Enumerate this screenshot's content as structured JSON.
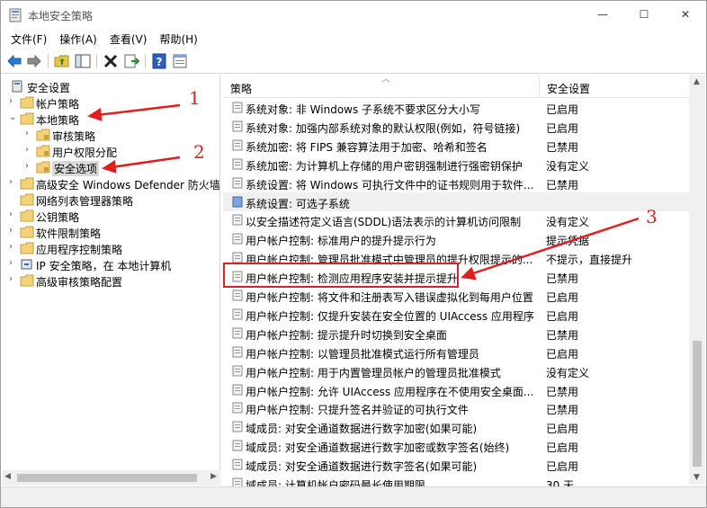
{
  "window": {
    "title": "本地安全策略",
    "min_glyph": "—",
    "max_glyph": "☐",
    "close_glyph": "✕"
  },
  "menu": [
    "文件(F)",
    "操作(A)",
    "查看(V)",
    "帮助(H)"
  ],
  "tree": [
    {
      "label": "安全设置",
      "level": 0,
      "expanded": true,
      "icon": "security-settings-icon"
    },
    {
      "label": "帐户策略",
      "level": 1,
      "expanded": false,
      "icon": "folder-icon"
    },
    {
      "label": "本地策略",
      "level": 1,
      "expanded": true,
      "icon": "folder-icon"
    },
    {
      "label": "审核策略",
      "level": 2,
      "expanded": false,
      "icon": "folder-icon"
    },
    {
      "label": "用户权限分配",
      "level": 2,
      "expanded": false,
      "icon": "folder-icon"
    },
    {
      "label": "安全选项",
      "level": 2,
      "expanded": false,
      "icon": "folder-icon",
      "selected": true
    },
    {
      "label": "高级安全 Windows Defender 防火墙",
      "level": 1,
      "expanded": false,
      "icon": "folder-icon"
    },
    {
      "label": "网络列表管理器策略",
      "level": 1,
      "expanded": null,
      "icon": "folder-icon"
    },
    {
      "label": "公钥策略",
      "level": 1,
      "expanded": false,
      "icon": "folder-icon"
    },
    {
      "label": "软件限制策略",
      "level": 1,
      "expanded": false,
      "icon": "folder-icon"
    },
    {
      "label": "应用程序控制策略",
      "level": 1,
      "expanded": false,
      "icon": "folder-icon"
    },
    {
      "label": "IP 安全策略，在 本地计算机",
      "level": 1,
      "expanded": false,
      "icon": "ip-security-icon"
    },
    {
      "label": "高级审核策略配置",
      "level": 1,
      "expanded": false,
      "icon": "folder-icon"
    }
  ],
  "columns": {
    "policy": "策略",
    "setting": "安全设置"
  },
  "rows": [
    {
      "policy": "系统对象: 非 Windows 子系统不要求区分大小写",
      "setting": "已启用"
    },
    {
      "policy": "系统对象: 加强内部系统对象的默认权限(例如，符号链接)",
      "setting": "已启用"
    },
    {
      "policy": "系统加密: 将 FIPS 兼容算法用于加密、哈希和签名",
      "setting": "已禁用"
    },
    {
      "policy": "系统加密: 为计算机上存储的用户密钥强制进行强密钥保护",
      "setting": "没有定义"
    },
    {
      "policy": "系统设置: 将 Windows 可执行文件中的证书规则用于软件...",
      "setting": "已禁用"
    },
    {
      "policy": "系统设置: 可选子系统",
      "setting": ""
    },
    {
      "policy": "以安全描述符定义语言(SDDL)语法表示的计算机访问限制",
      "setting": "没有定义"
    },
    {
      "policy": "用户帐户控制: 标准用户的提升提示行为",
      "setting": "提示凭据"
    },
    {
      "policy": "用户帐户控制: 管理员批准模式中管理员的提升权限提示的...",
      "setting": "不提示，直接提升"
    },
    {
      "policy": "用户帐户控制: 检测应用程序安装并提示提升",
      "setting": "已禁用"
    },
    {
      "policy": "用户帐户控制: 将文件和注册表写入错误虚拟化到每用户位置",
      "setting": "已启用"
    },
    {
      "policy": "用户帐户控制: 仅提升安装在安全位置的 UIAccess 应用程序",
      "setting": "已启用"
    },
    {
      "policy": "用户帐户控制: 提示提升时切换到安全桌面",
      "setting": "已禁用"
    },
    {
      "policy": "用户帐户控制: 以管理员批准模式运行所有管理员",
      "setting": "已启用"
    },
    {
      "policy": "用户帐户控制: 用于内置管理员帐户的管理员批准模式",
      "setting": "没有定义"
    },
    {
      "policy": "用户帐户控制: 允许 UIAccess 应用程序在不使用安全桌面...",
      "setting": "已禁用"
    },
    {
      "policy": "用户帐户控制: 只提升签名并验证的可执行文件",
      "setting": "已禁用"
    },
    {
      "policy": "域成员: 对安全通道数据进行数字加密(如果可能)",
      "setting": "已启用"
    },
    {
      "policy": "域成员: 对安全通道数据进行数字加密或数字签名(始终)",
      "setting": "已启用"
    },
    {
      "policy": "域成员: 对安全通道数据进行数字签名(如果可能)",
      "setting": "已启用"
    },
    {
      "policy": "域成员: 计算机帐户密码最长使用期限",
      "setting": "30 天"
    }
  ],
  "annotations": {
    "n1": "1",
    "n2": "2",
    "n3": "3"
  },
  "accent_red": "#e02020"
}
